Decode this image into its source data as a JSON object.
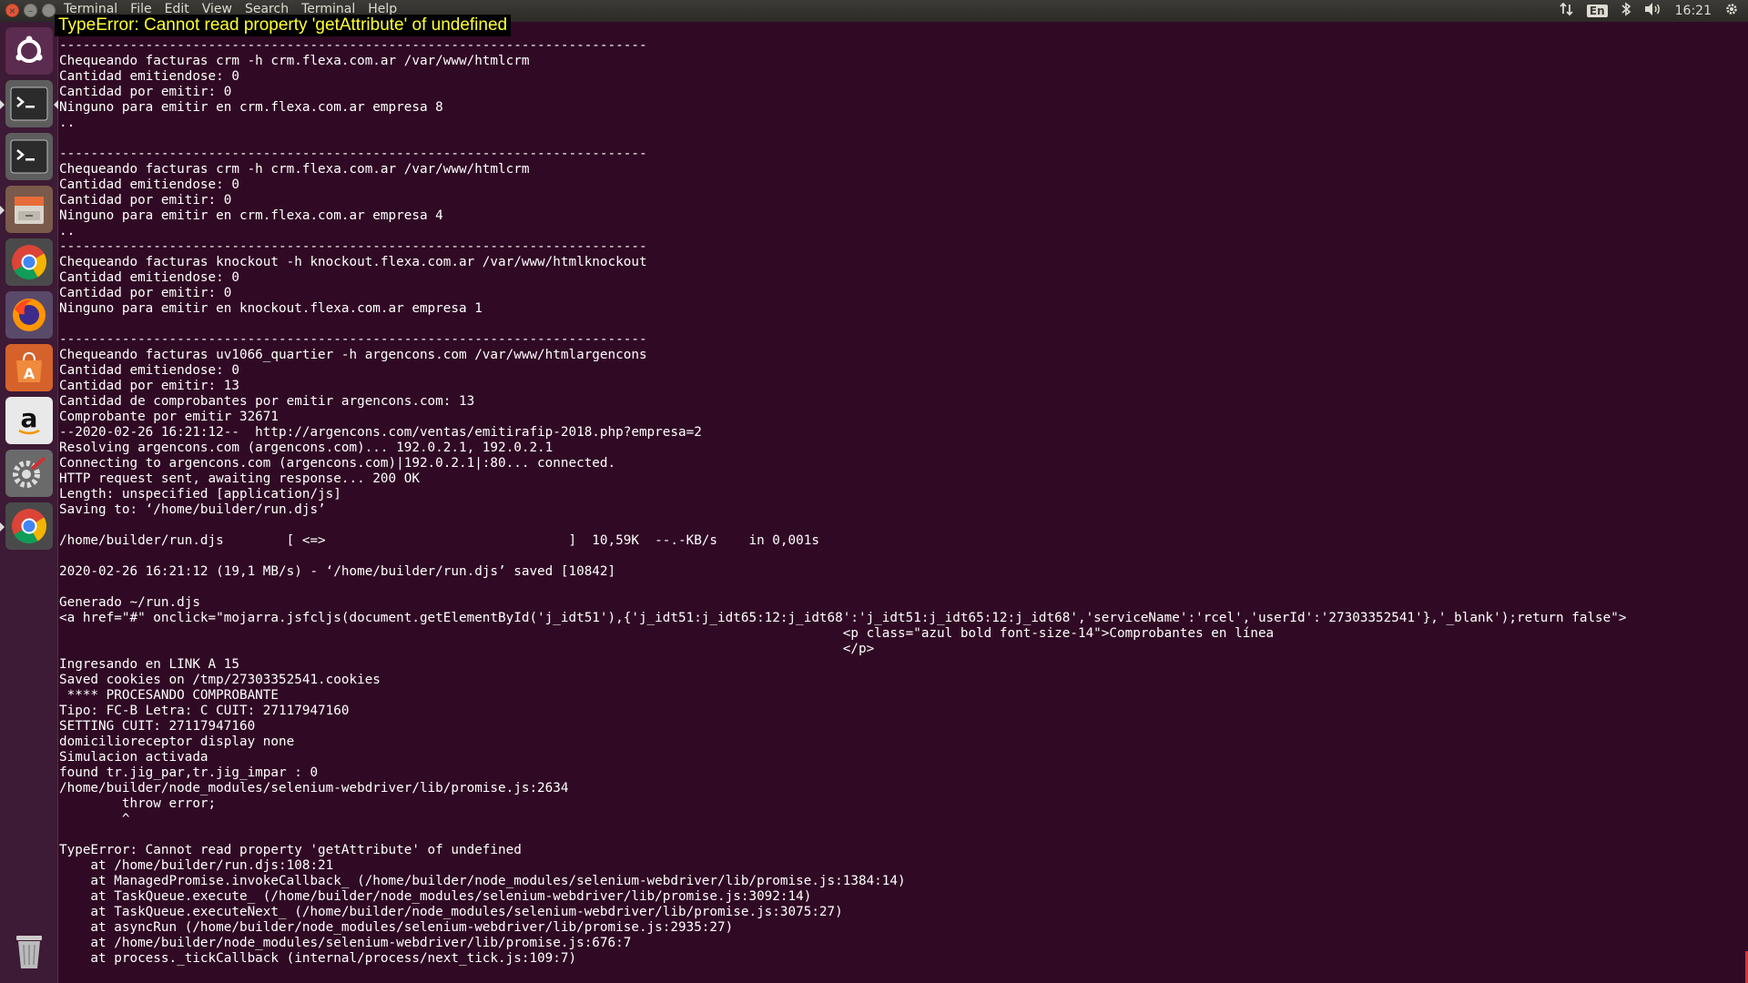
{
  "window": {
    "menu": [
      "Terminal",
      "File",
      "Edit",
      "View",
      "Search",
      "Terminal",
      "Help"
    ]
  },
  "tray": {
    "network_icon": "network-updown-icon",
    "keyboard_layout": "En",
    "bluetooth_icon": "bluetooth-icon",
    "volume_icon": "volume-icon",
    "time": "16:21",
    "settings_icon": "gear-icon"
  },
  "error_overlay": "TypeError: Cannot read property 'getAttribute' of undefined",
  "launcher": {
    "items": [
      {
        "name": "ubuntu-dash-icon"
      },
      {
        "name": "terminal-icon"
      },
      {
        "name": "terminal-icon"
      },
      {
        "name": "file-cabinet-icon"
      },
      {
        "name": "chrome-icon"
      },
      {
        "name": "firefox-icon"
      },
      {
        "name": "software-center-icon"
      },
      {
        "name": "amazon-icon"
      },
      {
        "name": "system-settings-icon"
      },
      {
        "name": "chrome-icon"
      },
      {
        "name": "trash-icon"
      }
    ]
  },
  "terminal": {
    "lines": [
      "---------------------------------------------------------------------------",
      "Chequeando facturas crm -h crm.flexa.com.ar /var/www/htmlcrm",
      "Cantidad emitiendose: 0",
      "Cantidad por emitir: 0",
      "Ninguno para emitir en crm.flexa.com.ar empresa 8",
      "..",
      "",
      "---------------------------------------------------------------------------",
      "Chequeando facturas crm -h crm.flexa.com.ar /var/www/htmlcrm",
      "Cantidad emitiendose: 0",
      "Cantidad por emitir: 0",
      "Ninguno para emitir en crm.flexa.com.ar empresa 4",
      "..",
      "---------------------------------------------------------------------------",
      "Chequeando facturas knockout -h knockout.flexa.com.ar /var/www/htmlknockout",
      "Cantidad emitiendose: 0",
      "Cantidad por emitir: 0",
      "Ninguno para emitir en knockout.flexa.com.ar empresa 1",
      "",
      "---------------------------------------------------------------------------",
      "Chequeando facturas uv1066_quartier -h argencons.com /var/www/htmlargencons",
      "Cantidad emitiendose: 0",
      "Cantidad por emitir: 13",
      "Cantidad de comprobantes por emitir argencons.com: 13",
      "Comprobante por emitir 32671",
      "--2020-02-26 16:21:12--  http://argencons.com/ventas/emitirafip-2018.php?empresa=2",
      "Resolving argencons.com (argencons.com)... 192.0.2.1, 192.0.2.1",
      "Connecting to argencons.com (argencons.com)|192.0.2.1|:80... connected.",
      "HTTP request sent, awaiting response... 200 OK",
      "Length: unspecified [application/js]",
      "Saving to: ‘/home/builder/run.djs’",
      "",
      "/home/builder/run.djs        [ <=>                               ]  10,59K  --.-KB/s    in 0,001s",
      "",
      "2020-02-26 16:21:12 (19,1 MB/s) - ‘/home/builder/run.djs’ saved [10842]",
      "",
      "Generado ~/run.djs",
      "<a href=\"#\" onclick=\"mojarra.jsfcljs(document.getElementById('j_idt51'),{'j_idt51:j_idt65:12:j_idt68':'j_idt51:j_idt65:12:j_idt68','serviceName':'rcel','userId':'27303352541'},'_blank');return false\">",
      "                                                                                                    <p class=\"azul bold font-size-14\">Comprobantes en línea",
      "                                                                                                    </p>",
      "Ingresando en LINK A 15",
      "Saved cookies on /tmp/27303352541.cookies",
      " **** PROCESANDO COMPROBANTE",
      "Tipo: FC-B Letra: C CUIT: 27117947160",
      "SETTING CUIT: 27117947160",
      "domicilioreceptor display none",
      "Simulacion activada",
      "found tr.jig_par,tr.jig_impar : 0",
      "/home/builder/node_modules/selenium-webdriver/lib/promise.js:2634",
      "        throw error;",
      "        ^",
      "",
      "TypeError: Cannot read property 'getAttribute' of undefined",
      "    at /home/builder/run.djs:108:21",
      "    at ManagedPromise.invokeCallback_ (/home/builder/node_modules/selenium-webdriver/lib/promise.js:1384:14)",
      "    at TaskQueue.execute_ (/home/builder/node_modules/selenium-webdriver/lib/promise.js:3092:14)",
      "    at TaskQueue.executeNext_ (/home/builder/node_modules/selenium-webdriver/lib/promise.js:3075:27)",
      "    at asyncRun (/home/builder/node_modules/selenium-webdriver/lib/promise.js:2935:27)",
      "    at /home/builder/node_modules/selenium-webdriver/lib/promise.js:676:7",
      "    at process._tickCallback (internal/process/next_tick.js:109:7)"
    ]
  }
}
